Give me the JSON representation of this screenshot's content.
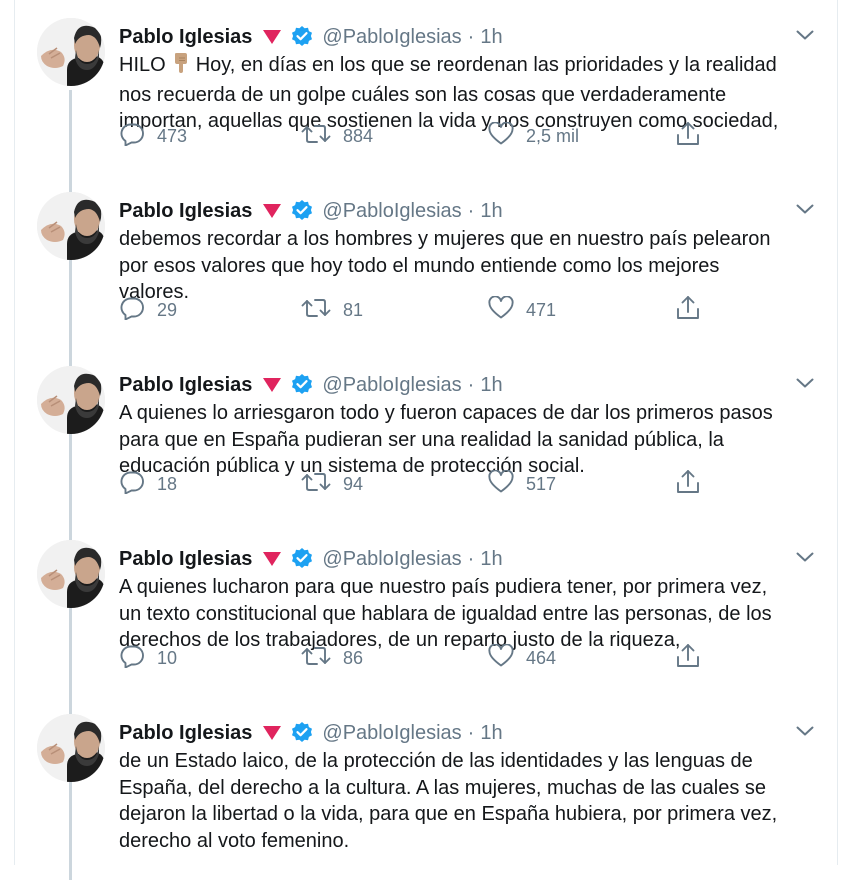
{
  "tweets": [
    {
      "name": "Pablo Iglesias",
      "handle": "@PabloIglesias",
      "separator": "·",
      "time": "1h",
      "lines": [
        "Hoy, en días en los que se reordenan las prioridades y la realidad",
        "nos recuerda de un golpe cuáles son las cosas que verdaderamente",
        "importan, aquellas que sostienen la vida y nos construyen como sociedad,"
      ],
      "lead": "HILO",
      "replies": "473",
      "retweets": "884",
      "likes": "2,5 mil"
    },
    {
      "name": "Pablo Iglesias",
      "handle": "@PabloIglesias",
      "separator": "·",
      "time": "1h",
      "lines": [
        "debemos recordar a los hombres y mujeres que en nuestro país pelearon",
        "por esos valores que hoy todo el mundo entiende como los mejores",
        "valores."
      ],
      "replies": "29",
      "retweets": "81",
      "likes": "471"
    },
    {
      "name": "Pablo Iglesias",
      "handle": "@PabloIglesias",
      "separator": "·",
      "time": "1h",
      "lines": [
        "A quienes lo arriesgaron todo y fueron capaces de dar los primeros pasos",
        "para que en España pudieran ser una realidad la sanidad pública, la",
        "educación pública y un sistema de protección social."
      ],
      "replies": "18",
      "retweets": "94",
      "likes": "517"
    },
    {
      "name": "Pablo Iglesias",
      "handle": "@PabloIglesias",
      "separator": "·",
      "time": "1h",
      "lines": [
        "A quienes lucharon para que nuestro país pudiera tener, por primera vez,",
        "un texto constitucional que hablara de igualdad entre las personas, de los",
        "derechos de los trabajadores, de un reparto justo de la riqueza,"
      ],
      "replies": "10",
      "retweets": "86",
      "likes": "464"
    },
    {
      "name": "Pablo Iglesias",
      "handle": "@PabloIglesias",
      "separator": "·",
      "time": "1h",
      "lines": [
        "de un Estado laico, de la protección de las identidades y las lenguas de",
        "España, del derecho a la cultura. A las mujeres, muchas de las cuales se",
        "dejaron la libertad o la vida, para que en España hubiera, por primera vez,",
        "derecho al voto femenino."
      ]
    }
  ],
  "icons": {
    "rose": "rose-icon",
    "verified": "verified-badge-icon",
    "reply": "reply-icon",
    "retweet": "retweet-icon",
    "like": "heart-icon",
    "share": "share-icon",
    "chevron": "chevron-down-icon",
    "hand": "pointing-down-hand-icon"
  },
  "colors": {
    "verified": "#1da1f2",
    "rose": "#e0245e",
    "muted": "#657786",
    "thread_line": "#ccd6dd"
  }
}
